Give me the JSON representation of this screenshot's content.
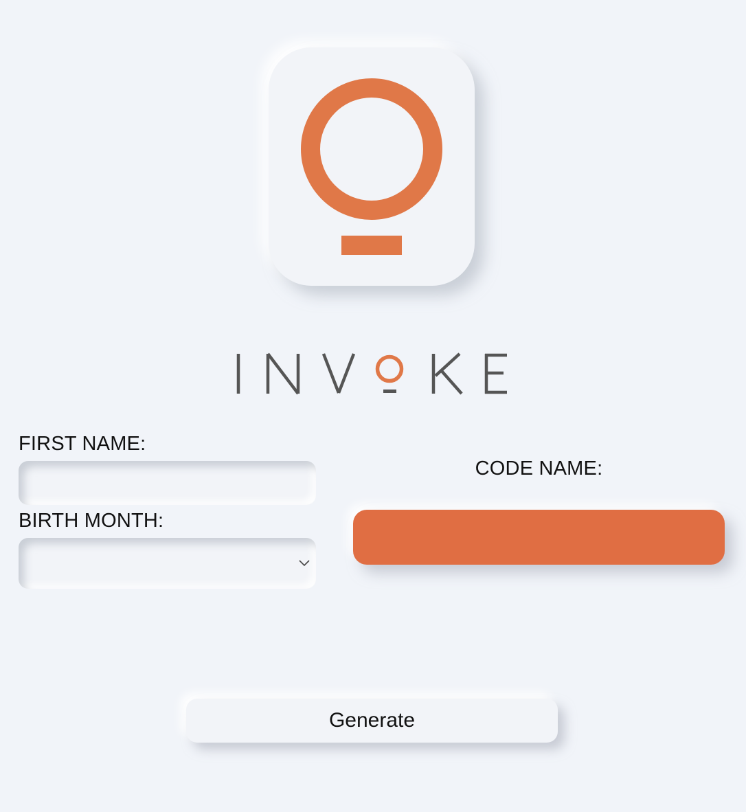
{
  "brand": {
    "name": "INVOKE",
    "accent_color": "#e07848",
    "text_color": "#555555",
    "logo_icon": "lightbulb-ring-icon"
  },
  "form": {
    "first_name_label": "FIRST NAME:",
    "first_name_value": "",
    "birth_month_label": "BIRTH MONTH:",
    "birth_month_selected": ""
  },
  "result": {
    "code_name_label": "CODE NAME:",
    "code_name_value": "",
    "color": "#e06e43"
  },
  "actions": {
    "generate_label": "Generate"
  }
}
